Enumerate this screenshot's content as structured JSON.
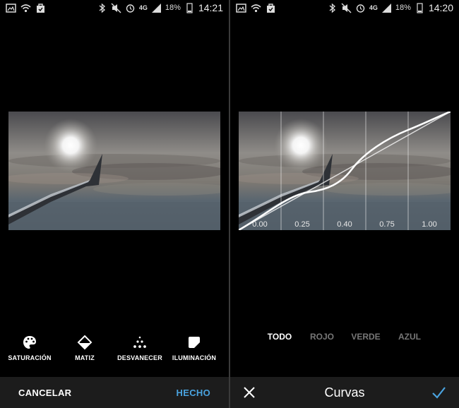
{
  "left_screen": {
    "status": {
      "network": "4G",
      "battery": "18%",
      "time": "14:21"
    },
    "tools": [
      {
        "label": "SATURACIÓN",
        "icon": "palette-icon"
      },
      {
        "label": "MATIZ",
        "icon": "tint-icon"
      },
      {
        "label": "DESVANECER",
        "icon": "fade-dots-icon"
      },
      {
        "label": "ILUMINACIÓN",
        "icon": "vignette-icon"
      }
    ],
    "cancel_label": "CANCELAR",
    "done_label": "HECHO"
  },
  "right_screen": {
    "status": {
      "network": "4G",
      "battery": "18%",
      "time": "14:20"
    },
    "curve_ticks": [
      "0.00",
      "0.25",
      "0.40",
      "0.75",
      "1.00"
    ],
    "channels": [
      {
        "label": "TODO",
        "active": true
      },
      {
        "label": "ROJO",
        "active": false
      },
      {
        "label": "VERDE",
        "active": false
      },
      {
        "label": "AZUL",
        "active": false
      }
    ],
    "title": "Curvas"
  },
  "colors": {
    "accent": "#4aa3df",
    "bar": "#1c1c1c",
    "inactive": "#777777"
  }
}
